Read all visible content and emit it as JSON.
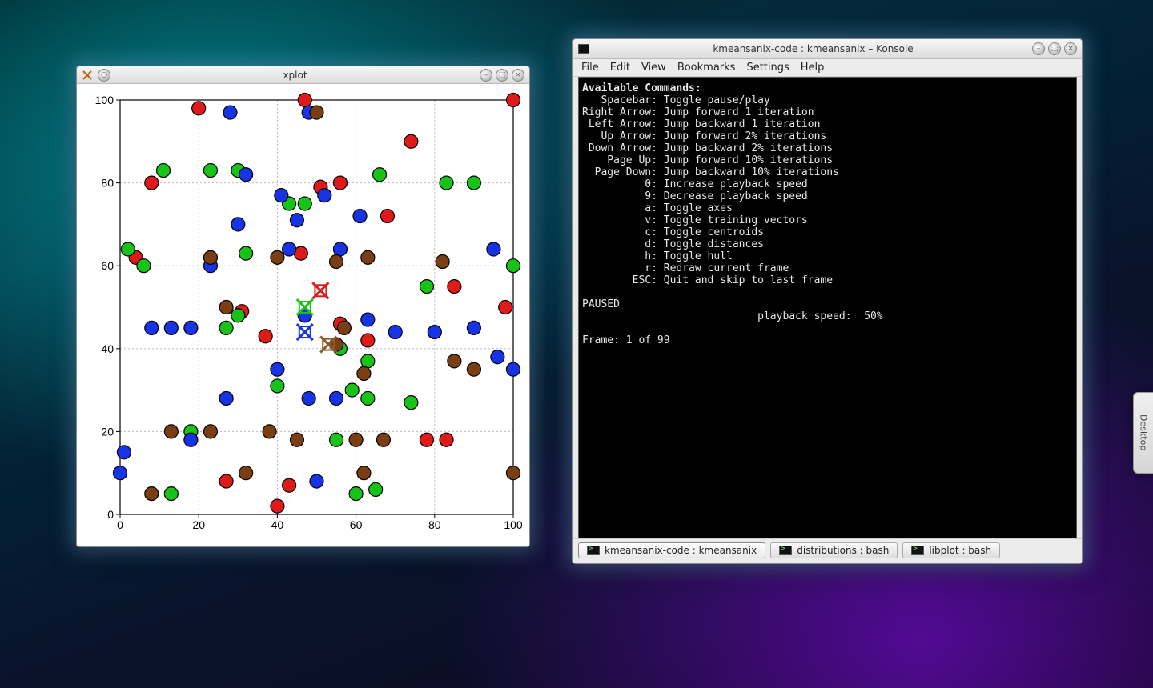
{
  "xplot": {
    "title": "xplot",
    "app_icon": "x-app-icon"
  },
  "konsole": {
    "title": "kmeansanix-code : kmeansanix – Konsole",
    "menu": [
      "File",
      "Edit",
      "View",
      "Bookmarks",
      "Settings",
      "Help"
    ],
    "tabs": [
      {
        "label": "kmeansanix-code : kmeansanix",
        "active": true
      },
      {
        "label": "distributions : bash",
        "active": false
      },
      {
        "label": "libplot : bash",
        "active": false
      }
    ],
    "term": {
      "header": "Available Commands:",
      "lines": [
        "   Spacebar: Toggle pause/play",
        "Right Arrow: Jump forward 1 iteration",
        " Left Arrow: Jump backward 1 iteration",
        "   Up Arrow: Jump forward 2% iterations",
        " Down Arrow: Jump backward 2% iterations",
        "    Page Up: Jump forward 10% iterations",
        "  Page Down: Jump backward 10% iterations",
        "          0: Increase playback speed",
        "          9: Decrease playback speed",
        "          a: Toggle axes",
        "          v: Toggle training vectors",
        "          c: Toggle centroids",
        "          d: Toggle distances",
        "          h: Toggle hull",
        "          r: Redraw current frame",
        "        ESC: Quit and skip to last frame"
      ],
      "status_paused": "PAUSED",
      "speed_line": "                            playback speed:  50%",
      "frame_line": "Frame: 1 of 99"
    }
  },
  "pager": {
    "label": "Desktop"
  },
  "chart_data": {
    "type": "scatter",
    "title": "",
    "xlabel": "",
    "ylabel": "",
    "xlim": [
      0,
      100
    ],
    "ylim": [
      0,
      100
    ],
    "x_ticks": [
      0,
      20,
      40,
      60,
      80,
      100
    ],
    "y_ticks": [
      0,
      20,
      40,
      60,
      80,
      100
    ],
    "grid": true,
    "series": [
      {
        "name": "cluster-red",
        "color": "#e01919",
        "points": [
          [
            4,
            62
          ],
          [
            8,
            80
          ],
          [
            20,
            98
          ],
          [
            27,
            8
          ],
          [
            31,
            49
          ],
          [
            37,
            43
          ],
          [
            40,
            2
          ],
          [
            43,
            7
          ],
          [
            46,
            63
          ],
          [
            47,
            100
          ],
          [
            51,
            79
          ],
          [
            56,
            80
          ],
          [
            56,
            46
          ],
          [
            63,
            42
          ],
          [
            68,
            72
          ],
          [
            74,
            90
          ],
          [
            78,
            18
          ],
          [
            83,
            18
          ],
          [
            85,
            55
          ],
          [
            98,
            50
          ],
          [
            100,
            100
          ]
        ]
      },
      {
        "name": "cluster-green",
        "color": "#18c318",
        "points": [
          [
            2,
            64
          ],
          [
            6,
            60
          ],
          [
            11,
            83
          ],
          [
            13,
            5
          ],
          [
            18,
            20
          ],
          [
            23,
            83
          ],
          [
            27,
            45
          ],
          [
            30,
            48
          ],
          [
            30,
            83
          ],
          [
            32,
            63
          ],
          [
            40,
            31
          ],
          [
            43,
            75
          ],
          [
            47,
            75
          ],
          [
            55,
            18
          ],
          [
            56,
            40
          ],
          [
            59,
            30
          ],
          [
            60,
            5
          ],
          [
            63,
            28
          ],
          [
            63,
            37
          ],
          [
            65,
            6
          ],
          [
            66,
            82
          ],
          [
            74,
            27
          ],
          [
            78,
            55
          ],
          [
            83,
            80
          ],
          [
            90,
            80
          ],
          [
            100,
            60
          ]
        ]
      },
      {
        "name": "cluster-blue",
        "color": "#1733e6",
        "points": [
          [
            0,
            10
          ],
          [
            1,
            15
          ],
          [
            8,
            45
          ],
          [
            13,
            45
          ],
          [
            18,
            45
          ],
          [
            18,
            18
          ],
          [
            23,
            60
          ],
          [
            27,
            28
          ],
          [
            28,
            97
          ],
          [
            30,
            70
          ],
          [
            32,
            82
          ],
          [
            40,
            35
          ],
          [
            41,
            77
          ],
          [
            43,
            64
          ],
          [
            45,
            71
          ],
          [
            48,
            97
          ],
          [
            47,
            48
          ],
          [
            48,
            28
          ],
          [
            50,
            8
          ],
          [
            52,
            77
          ],
          [
            55,
            28
          ],
          [
            56,
            64
          ],
          [
            61,
            72
          ],
          [
            63,
            47
          ],
          [
            70,
            44
          ],
          [
            80,
            44
          ],
          [
            90,
            45
          ],
          [
            95,
            64
          ],
          [
            96,
            38
          ],
          [
            100,
            35
          ]
        ]
      },
      {
        "name": "cluster-brown",
        "color": "#7a3e12",
        "points": [
          [
            8,
            5
          ],
          [
            13,
            20
          ],
          [
            23,
            20
          ],
          [
            23,
            62
          ],
          [
            27,
            50
          ],
          [
            32,
            10
          ],
          [
            38,
            20
          ],
          [
            40,
            62
          ],
          [
            45,
            18
          ],
          [
            50,
            97
          ],
          [
            55,
            41
          ],
          [
            55,
            61
          ],
          [
            57,
            45
          ],
          [
            62,
            10
          ],
          [
            60,
            18
          ],
          [
            62,
            34
          ],
          [
            63,
            62
          ],
          [
            67,
            18
          ],
          [
            82,
            61
          ],
          [
            85,
            37
          ],
          [
            90,
            35
          ],
          [
            100,
            10
          ]
        ]
      }
    ],
    "centroids": [
      {
        "name": "centroid-red",
        "color": "#e01919",
        "x": 51,
        "y": 54
      },
      {
        "name": "centroid-green",
        "color": "#18c318",
        "x": 47,
        "y": 50
      },
      {
        "name": "centroid-blue",
        "color": "#1733e6",
        "x": 47,
        "y": 44
      },
      {
        "name": "centroid-brown",
        "color": "#8a5a2a",
        "x": 53,
        "y": 41
      }
    ]
  }
}
